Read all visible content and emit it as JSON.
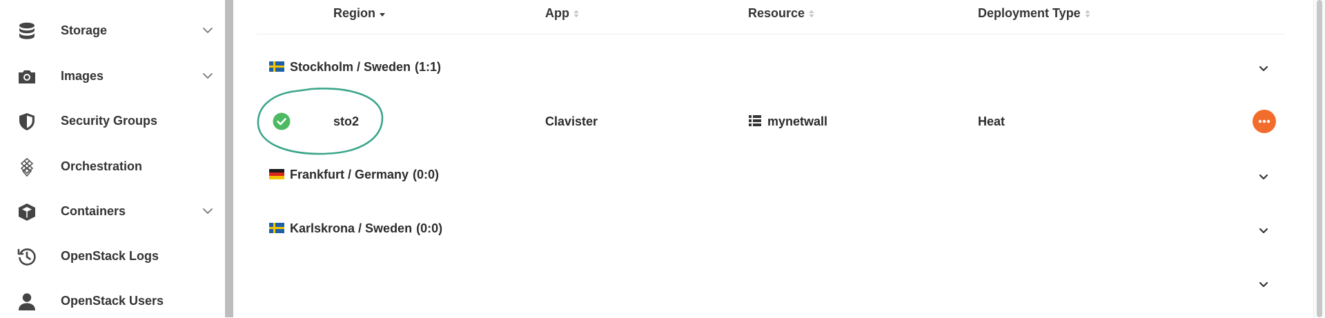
{
  "sidebar": {
    "items": [
      {
        "label": "Storage",
        "icon": "database-icon",
        "expandable": true
      },
      {
        "label": "Images",
        "icon": "camera-icon",
        "expandable": true
      },
      {
        "label": "Security Groups",
        "icon": "shield-icon",
        "expandable": false
      },
      {
        "label": "Orchestration",
        "icon": "orchestration-icon",
        "expandable": false
      },
      {
        "label": "Containers",
        "icon": "cube-icon",
        "expandable": true
      },
      {
        "label": "OpenStack Logs",
        "icon": "history-icon",
        "expandable": false
      },
      {
        "label": "OpenStack Users",
        "icon": "user-icon",
        "expandable": false
      }
    ]
  },
  "table": {
    "columns": [
      {
        "label": "Region",
        "sort": "descending"
      },
      {
        "label": "App",
        "sort": "none"
      },
      {
        "label": "Resource",
        "sort": "none"
      },
      {
        "label": "Deployment Type",
        "sort": "none"
      }
    ],
    "groups": [
      {
        "name": "Stockholm / Sweden",
        "count": "(1:1)",
        "flag": "sweden-flag-icon",
        "expanded": true
      },
      {
        "name": "Frankfurt / Germany",
        "count": "(0:0)",
        "flag": "germany-flag-icon",
        "expanded": false
      },
      {
        "name": "Karlskrona / Sweden",
        "count": "(0:0)",
        "flag": "sweden-flag-icon",
        "expanded": false
      }
    ],
    "rows": [
      {
        "region": "sto2",
        "app": "Clavister",
        "resource": "mynetwall",
        "deployment_type": "Heat",
        "status": "success"
      }
    ]
  },
  "colors": {
    "sidebar_divider": "#bdbdbd",
    "status_success": "#4cba62",
    "highlight_ring": "#3aa58a",
    "actions_button": "#f26c2b",
    "text": "#2b2b2b"
  }
}
